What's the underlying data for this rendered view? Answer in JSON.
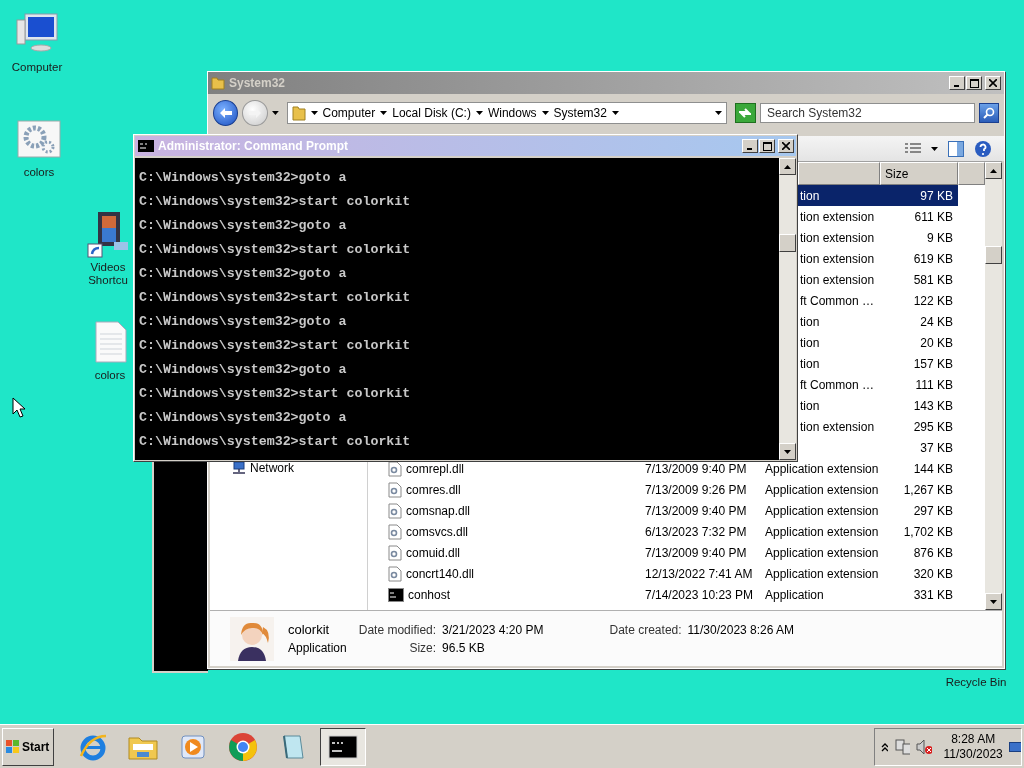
{
  "desktop_icons": [
    {
      "label": "Computer",
      "kind": "computer"
    },
    {
      "label": "colors",
      "kind": "settings"
    },
    {
      "label": "Videos Shortcu",
      "kind": "video"
    },
    {
      "label": "colors",
      "kind": "document"
    },
    {
      "label": "Recycle Bin",
      "kind": "label_only"
    }
  ],
  "explorer": {
    "title": "System32",
    "breadcrumbs": [
      "Computer",
      "Local Disk (C:)",
      "Windows",
      "System32"
    ],
    "search": {
      "placeholder": "Search System32"
    },
    "nav_items": [
      "Network"
    ],
    "columns": [
      "Size"
    ],
    "rows": [
      {
        "type": "tion",
        "size": "97 KB",
        "selected": true
      },
      {
        "type": "tion extension",
        "size": "611 KB",
        "selected": false
      },
      {
        "type": "tion extension",
        "size": "9 KB",
        "selected": false
      },
      {
        "type": "tion extension",
        "size": "619 KB",
        "selected": false
      },
      {
        "type": "tion extension",
        "size": "581 KB",
        "selected": false
      },
      {
        "type": "ft Common …",
        "size": "122 KB",
        "selected": false
      },
      {
        "type": "tion",
        "size": "24 KB",
        "selected": false
      },
      {
        "type": "tion",
        "size": "20 KB",
        "selected": false
      },
      {
        "type": "tion",
        "size": "157 KB",
        "selected": false
      },
      {
        "type": "ft Common …",
        "size": "111 KB",
        "selected": false
      },
      {
        "type": "tion",
        "size": "143 KB",
        "selected": false
      },
      {
        "type": "tion extension",
        "size": "295 KB",
        "selected": false
      },
      {
        "size": "37 KB",
        "selected": false
      },
      {
        "kind": "dll",
        "name": "comrepl.dll",
        "date": "7/13/2009 9:40 PM",
        "type": "Application extension",
        "size": "144 KB",
        "selected": false
      },
      {
        "kind": "dll",
        "name": "comres.dll",
        "date": "7/13/2009 9:26 PM",
        "type": "Application extension",
        "size": "1,267 KB",
        "selected": false
      },
      {
        "kind": "dll",
        "name": "comsnap.dll",
        "date": "7/13/2009 9:40 PM",
        "type": "Application extension",
        "size": "297 KB",
        "selected": false
      },
      {
        "kind": "dll",
        "name": "comsvcs.dll",
        "date": "6/13/2023 7:32 PM",
        "type": "Application extension",
        "size": "1,702 KB",
        "selected": false
      },
      {
        "kind": "dll",
        "name": "comuid.dll",
        "date": "7/13/2009 9:40 PM",
        "type": "Application extension",
        "size": "876 KB",
        "selected": false
      },
      {
        "kind": "dll",
        "name": "concrt140.dll",
        "date": "12/13/2022 7:41 AM",
        "type": "Application extension",
        "size": "320 KB",
        "selected": false
      },
      {
        "kind": "exe",
        "name": "conhost",
        "date": "7/14/2023 10:23 PM",
        "type": "Application",
        "size": "331 KB",
        "selected": false
      }
    ],
    "details": {
      "name": "colorkit",
      "type": "Application",
      "modified_label": "Date modified:",
      "modified": "3/21/2023 4:20 PM",
      "created_label": "Date created:",
      "created": "11/30/2023 8:26 AM",
      "size_label": "Size:",
      "size": "96.5 KB"
    }
  },
  "console": {
    "title": "Administrator: Command Prompt",
    "lines": [
      "C:\\Windows\\system32>goto a",
      "C:\\Windows\\system32>start colorkit",
      "C:\\Windows\\system32>goto a",
      "C:\\Windows\\system32>start colorkit",
      "C:\\Windows\\system32>goto a",
      "C:\\Windows\\system32>start colorkit",
      "C:\\Windows\\system32>goto a",
      "C:\\Windows\\system32>start colorkit",
      "C:\\Windows\\system32>goto a",
      "C:\\Windows\\system32>start colorkit",
      "C:\\Windows\\system32>goto a",
      "C:\\Windows\\system32>start colorkit"
    ]
  },
  "taskbar": {
    "start": "Start",
    "apps": [
      {
        "kind": "browser_e",
        "selected": false
      },
      {
        "kind": "folder",
        "selected": false
      },
      {
        "kind": "media",
        "selected": false
      },
      {
        "kind": "chrome",
        "selected": false
      },
      {
        "kind": "notepad",
        "selected": false
      },
      {
        "kind": "console",
        "selected": true
      }
    ],
    "time": "8:28 AM",
    "date": "11/30/2023"
  }
}
